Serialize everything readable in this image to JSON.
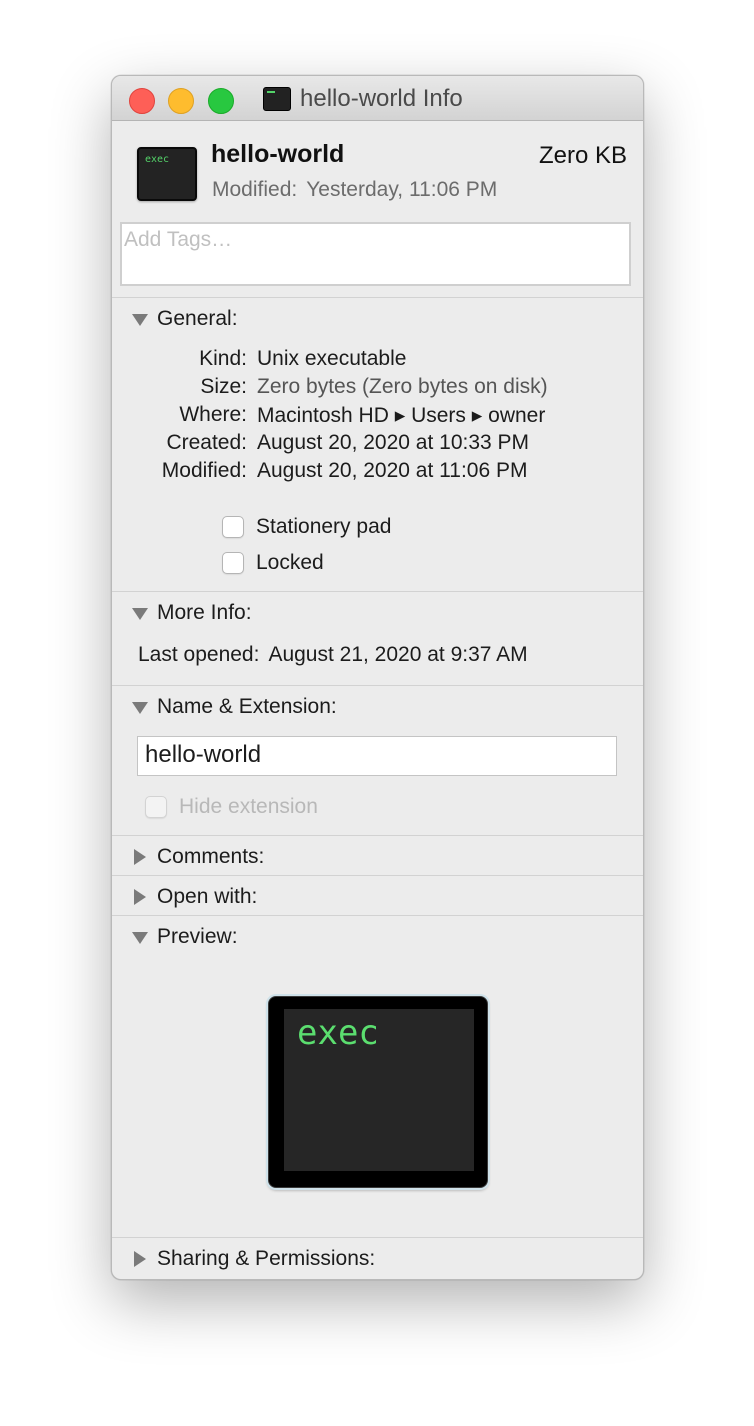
{
  "window": {
    "title": "hello-world Info",
    "traffic_lights": [
      "close",
      "minimize",
      "zoom"
    ]
  },
  "file": {
    "name": "hello-world",
    "size": "Zero KB",
    "modified_label": "Modified:",
    "modified_value": "Yesterday, 11:06 PM",
    "icon_text": "exec"
  },
  "tags": {
    "placeholder": "Add Tags…"
  },
  "general": {
    "label": "General:",
    "rows": [
      {
        "key": "Kind:",
        "value": "Unix executable"
      },
      {
        "key": "Size:",
        "value": "Zero bytes (Zero bytes on disk)"
      },
      {
        "key": "Where:",
        "value": "Macintosh HD ▸ Users ▸ owner"
      },
      {
        "key": "Created:",
        "value": "August 20, 2020 at 10:33 PM"
      },
      {
        "key": "Modified:",
        "value": "August 20, 2020 at 11:06 PM"
      }
    ],
    "stationery_pad": {
      "label": "Stationery pad",
      "checked": false
    },
    "locked": {
      "label": "Locked",
      "checked": false
    }
  },
  "more_info": {
    "label": "More Info:",
    "last_opened_label": "Last opened:",
    "last_opened_value": "August 21, 2020 at 9:37 AM"
  },
  "name_extension": {
    "label": "Name & Extension:",
    "name_value": "hello-world",
    "hide_extension": {
      "label": "Hide extension",
      "checked": false,
      "enabled": false
    }
  },
  "comments": {
    "label": "Comments:"
  },
  "open_with": {
    "label": "Open with:"
  },
  "preview": {
    "label": "Preview:",
    "icon_text": "exec"
  },
  "sharing": {
    "label": "Sharing & Permissions:"
  },
  "colors": {
    "window_bg": "#ececec",
    "terminal_green": "#5bde6f",
    "close": "#fe5f57",
    "minimize": "#febc2e",
    "zoom": "#28c840"
  }
}
